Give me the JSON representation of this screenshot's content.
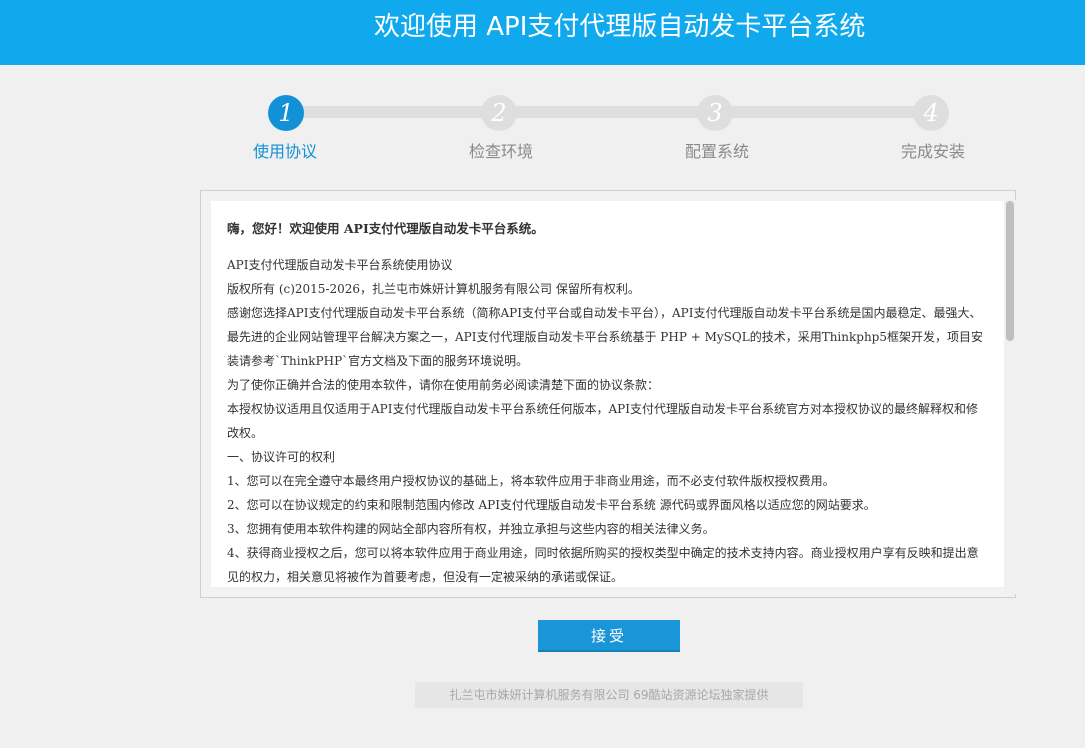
{
  "header": {
    "title": "欢迎使用 API支付代理版自动发卡平台系统"
  },
  "steps": [
    {
      "number": "1",
      "label": "使用协议",
      "active": true
    },
    {
      "number": "2",
      "label": "检查环境",
      "active": false
    },
    {
      "number": "3",
      "label": "配置系统",
      "active": false
    },
    {
      "number": "4",
      "label": "完成安装",
      "active": false
    }
  ],
  "agreement": {
    "heading": "嗨，您好！欢迎使用 API支付代理版自动发卡平台系统。",
    "paragraphs": [
      "API支付代理版自动发卡平台系统使用协议",
      "版权所有 (c)2015-2026，扎兰屯市姝妍计算机服务有限公司 保留所有权利。",
      "感谢您选择API支付代理版自动发卡平台系统（简称API支付平台或自动发卡平台），API支付代理版自动发卡平台系统是国内最稳定、最强大、最先进的企业网站管理平台解决方案之一，API支付代理版自动发卡平台系统基于 PHP + MySQL的技术，采用Thinkphp5框架开发，项目安装请参考`ThinkPHP`官方文档及下面的服务环境说明。",
      "为了使你正确并合法的使用本软件，请你在使用前务必阅读清楚下面的协议条款：",
      "本授权协议适用且仅适用于API支付代理版自动发卡平台系统任何版本，API支付代理版自动发卡平台系统官方对本授权协议的最终解释权和修改权。",
      "一、协议许可的权利",
      "1、您可以在完全遵守本最终用户授权协议的基础上，将本软件应用于非商业用途，而不必支付软件版权授权费用。",
      "2、您可以在协议规定的约束和限制范围内修改 API支付代理版自动发卡平台系统 源代码或界面风格以适应您的网站要求。",
      "3、您拥有使用本软件构建的网站全部内容所有权，并独立承担与这些内容的相关法律义务。",
      "4、获得商业授权之后，您可以将本软件应用于商业用途，同时依据所购买的授权类型中确定的技术支持内容。商业授权用户享有反映和提出意见的权力，相关意见将被作为首要考虑，但没有一定被采纳的承诺或保证。"
    ]
  },
  "actions": {
    "accept_label": "接受"
  },
  "footer": {
    "text": "扎兰屯市姝妍计算机服务有限公司 69酷站资源论坛独家提供"
  },
  "colors": {
    "header_bg": "#11a9ee",
    "active_step": "#1391d6",
    "inactive_step": "#dedede",
    "button_bg": "#1a96d8"
  }
}
